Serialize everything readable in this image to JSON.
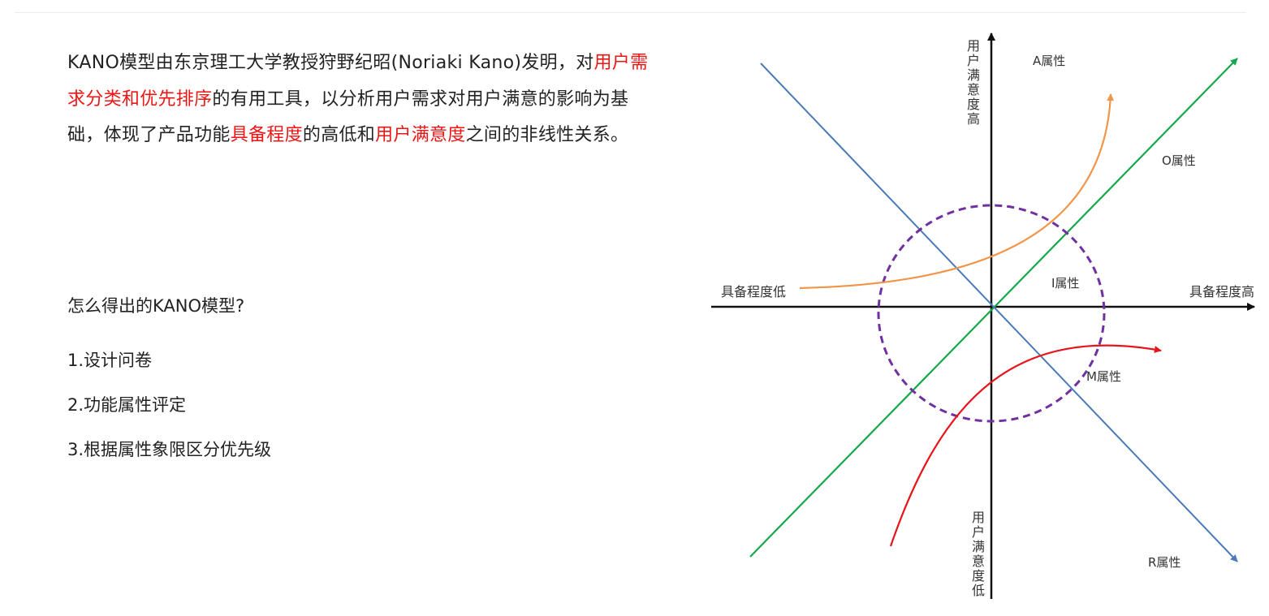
{
  "intro": {
    "t1": "KANO模型由东京理工大学教授狩野纪昭(Noriaki Kano)发明，对",
    "h1": "用户需求分类和优先排序",
    "t2": "的有用工具，以分析用户需求对用户满意的影响为基础，体现了产品功能",
    "h2": "具备程度",
    "t3": "的高低和",
    "h3": "用户满意度",
    "t4": "之间的非线性关系。"
  },
  "question": "怎么得出的KANO模型?",
  "steps": [
    "1.设计问卷",
    "2.功能属性评定",
    "3.根据属性象限区分优先级"
  ],
  "diagram": {
    "axis_x_low": "具备程度低",
    "axis_x_high": "具备程度高",
    "axis_y_high": [
      "用",
      "户",
      "满",
      "意",
      "度",
      "高"
    ],
    "axis_y_low": [
      "用",
      "户",
      "满",
      "意",
      "度",
      "低"
    ],
    "attr_a": "A属性",
    "attr_o": "O属性",
    "attr_i": "I属性",
    "attr_m": "M属性",
    "attr_r": "R属性",
    "colors": {
      "axis": "#111111",
      "a_curve": "#f0964a",
      "o_line": "#13a84a",
      "r_line": "#4a7ab8",
      "m_curve": "#e8141c",
      "i_circle": "#7030a0"
    }
  }
}
